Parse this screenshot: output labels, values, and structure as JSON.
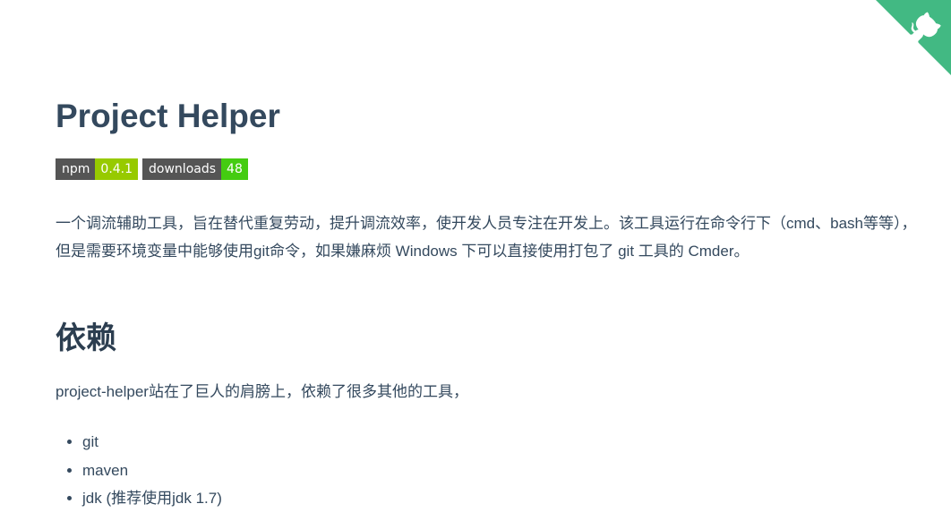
{
  "page": {
    "title": "Project Helper",
    "badges": [
      {
        "label": "npm",
        "value": "0.4.1"
      },
      {
        "label": "downloads",
        "value": "48"
      }
    ],
    "description": "一个调流辅助工具，旨在替代重复劳动，提升调流效率，使开发人员专注在开发上。该工具运行在命令行下（cmd、bash等等），但是需要环境变量中能够使用git命令，如果嫌麻烦 Windows 下可以直接使用打包了 git 工具的 Cmder。"
  },
  "dependencies": {
    "heading": "依赖",
    "intro": "project-helper站在了巨人的肩膀上，依赖了很多其他的工具，",
    "items": [
      "git",
      "maven",
      "jdk (推荐使用jdk 1.7)"
    ]
  },
  "corner": {
    "icon": "github-octocat-icon",
    "color": "#42b983"
  },
  "colors": {
    "text": "#34495e",
    "heading": "#2c3e50",
    "badge_label_bg": "#555555",
    "badge_npm_bg": "#97ca00",
    "badge_downloads_bg": "#44cc11"
  }
}
